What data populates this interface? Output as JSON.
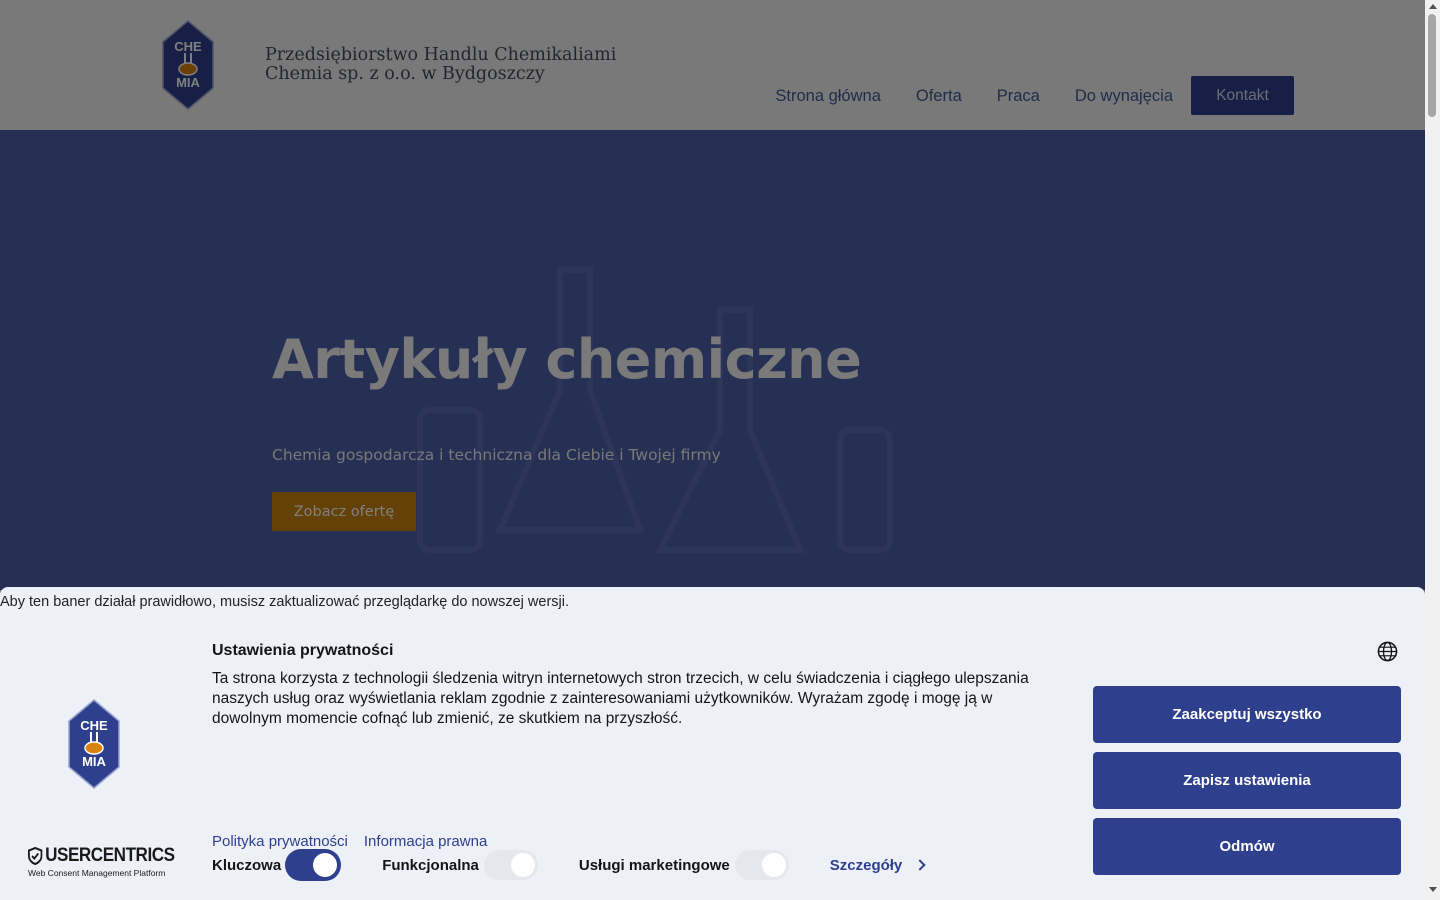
{
  "header": {
    "company_line1": "Przedsiębiorstwo Handlu Chemikaliami",
    "company_line2": "Chemia sp. z o.o. w Bydgoszczy",
    "logo_text_top": "CHE",
    "logo_text_bottom": "MIA",
    "nav": {
      "home": "Strona główna",
      "offer": "Oferta",
      "jobs": "Praca",
      "rent": "Do wynajęcia",
      "contact": "Kontakt"
    }
  },
  "hero": {
    "title": "Artykuły chemiczne",
    "subtitle": "Chemia gospodarcza i techniczna dla Ciebie i Twojej firmy",
    "cta": "Zobacz ofertę"
  },
  "consent": {
    "browser_notice": "Aby ten baner działał prawidłowo, musisz zaktualizować przeglądarkę do nowszej wersji.",
    "title": "Ustawienia prywatności",
    "text": "Ta strona korzysta z technologii śledzenia witryn internetowych stron trzecich, w celu świadczenia i ciągłego ulepszania naszych usług oraz wyświetlania reklam zgodnie z zainteresowaniami użytkowników. Wyrażam zgodę i mogę ją w dowolnym momencie cofnąć lub zmienić, ze skutkiem na przyszłość.",
    "buttons": {
      "accept_all": "Zaakceptuj wszystko",
      "save": "Zapisz ustawienia",
      "deny": "Odmów"
    },
    "links": {
      "privacy": "Polityka prywatności",
      "legal": "Informacja prawna"
    },
    "toggles": {
      "essential": {
        "label": "Kluczowa",
        "on": true
      },
      "functional": {
        "label": "Funkcjonalna",
        "on": false
      },
      "marketing": {
        "label": "Usługi marketingowe",
        "on": false
      }
    },
    "details": "Szczegóły",
    "brand": "USERCENTRICS",
    "brand_sub": "Web Consent Management Platform"
  },
  "colors": {
    "brand_blue": "#2e3f8d",
    "hero_bg": "#4a5ca7",
    "cta_orange": "#c8840f",
    "banner_bg": "#edf1f7"
  }
}
